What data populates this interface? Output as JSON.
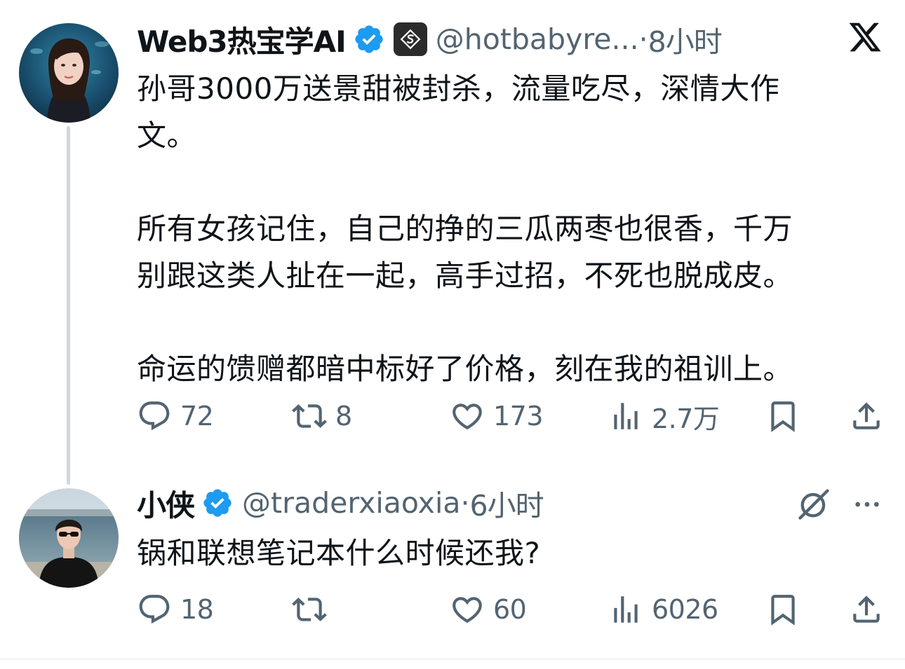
{
  "tweets": [
    {
      "display_name": "Web3热宝学AI",
      "handle": "@hotbabyre...",
      "separator": "·",
      "time": "8小时",
      "text_paragraphs": [
        [
          "孙哥3000万送景甜被封杀，流量吃尽，深情大作",
          "文。"
        ],
        [
          "所有女孩记住，自己的挣的三瓜两枣也很香，千万",
          "别跟这类人扯在一起，高手过招，不死也脱成皮。"
        ],
        [
          "命运的馈赠都暗中标好了价格，刻在我的祖训上。"
        ]
      ],
      "replies": "72",
      "retweets": "8",
      "likes": "173",
      "views": "2.7万"
    },
    {
      "display_name": "小侠",
      "handle": "@traderxiaoxia",
      "separator": "·",
      "time": "6小时",
      "text_paragraphs": [
        [
          "锅和联想笔记本什么时候还我?"
        ]
      ],
      "replies": "18",
      "retweets": "",
      "likes": "60",
      "views": "6026"
    }
  ],
  "icons": {
    "brand": "x-logo-icon",
    "verified": "verified-badge-icon",
    "affiliate": "affiliate-badge-icon",
    "reply": "reply-icon",
    "retweet": "retweet-icon",
    "like": "heart-icon",
    "views": "views-chart-icon",
    "bookmark": "bookmark-icon",
    "share": "share-icon",
    "grok": "grok-icon",
    "more": "more-icon"
  },
  "colors": {
    "text_primary": "#0f1419",
    "text_secondary": "#536471",
    "verified_blue": "#1d9bf0",
    "thread_line": "#cfd9de"
  }
}
